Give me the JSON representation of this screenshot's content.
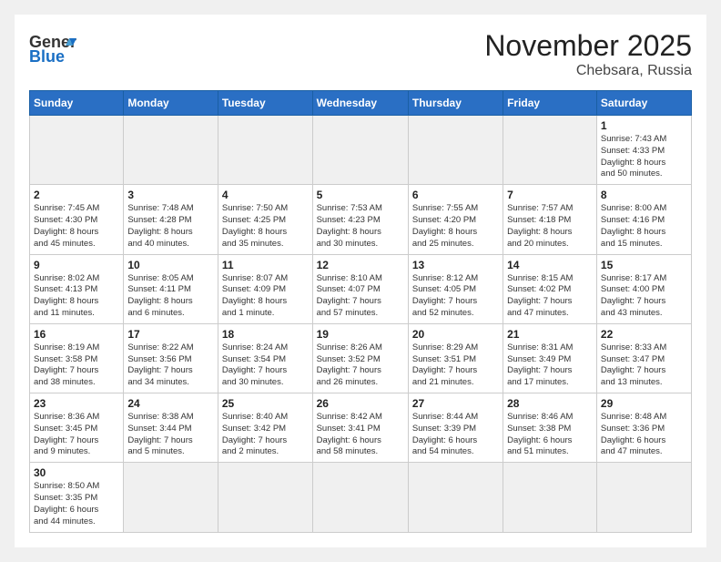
{
  "header": {
    "logo_general": "General",
    "logo_blue": "Blue",
    "title": "November 2025",
    "subtitle": "Chebsara, Russia"
  },
  "weekdays": [
    "Sunday",
    "Monday",
    "Tuesday",
    "Wednesday",
    "Thursday",
    "Friday",
    "Saturday"
  ],
  "weeks": [
    [
      {
        "day": "",
        "info": ""
      },
      {
        "day": "",
        "info": ""
      },
      {
        "day": "",
        "info": ""
      },
      {
        "day": "",
        "info": ""
      },
      {
        "day": "",
        "info": ""
      },
      {
        "day": "",
        "info": ""
      },
      {
        "day": "1",
        "info": "Sunrise: 7:43 AM\nSunset: 4:33 PM\nDaylight: 8 hours\nand 50 minutes."
      }
    ],
    [
      {
        "day": "2",
        "info": "Sunrise: 7:45 AM\nSunset: 4:30 PM\nDaylight: 8 hours\nand 45 minutes."
      },
      {
        "day": "3",
        "info": "Sunrise: 7:48 AM\nSunset: 4:28 PM\nDaylight: 8 hours\nand 40 minutes."
      },
      {
        "day": "4",
        "info": "Sunrise: 7:50 AM\nSunset: 4:25 PM\nDaylight: 8 hours\nand 35 minutes."
      },
      {
        "day": "5",
        "info": "Sunrise: 7:53 AM\nSunset: 4:23 PM\nDaylight: 8 hours\nand 30 minutes."
      },
      {
        "day": "6",
        "info": "Sunrise: 7:55 AM\nSunset: 4:20 PM\nDaylight: 8 hours\nand 25 minutes."
      },
      {
        "day": "7",
        "info": "Sunrise: 7:57 AM\nSunset: 4:18 PM\nDaylight: 8 hours\nand 20 minutes."
      },
      {
        "day": "8",
        "info": "Sunrise: 8:00 AM\nSunset: 4:16 PM\nDaylight: 8 hours\nand 15 minutes."
      }
    ],
    [
      {
        "day": "9",
        "info": "Sunrise: 8:02 AM\nSunset: 4:13 PM\nDaylight: 8 hours\nand 11 minutes."
      },
      {
        "day": "10",
        "info": "Sunrise: 8:05 AM\nSunset: 4:11 PM\nDaylight: 8 hours\nand 6 minutes."
      },
      {
        "day": "11",
        "info": "Sunrise: 8:07 AM\nSunset: 4:09 PM\nDaylight: 8 hours\nand 1 minute."
      },
      {
        "day": "12",
        "info": "Sunrise: 8:10 AM\nSunset: 4:07 PM\nDaylight: 7 hours\nand 57 minutes."
      },
      {
        "day": "13",
        "info": "Sunrise: 8:12 AM\nSunset: 4:05 PM\nDaylight: 7 hours\nand 52 minutes."
      },
      {
        "day": "14",
        "info": "Sunrise: 8:15 AM\nSunset: 4:02 PM\nDaylight: 7 hours\nand 47 minutes."
      },
      {
        "day": "15",
        "info": "Sunrise: 8:17 AM\nSunset: 4:00 PM\nDaylight: 7 hours\nand 43 minutes."
      }
    ],
    [
      {
        "day": "16",
        "info": "Sunrise: 8:19 AM\nSunset: 3:58 PM\nDaylight: 7 hours\nand 38 minutes."
      },
      {
        "day": "17",
        "info": "Sunrise: 8:22 AM\nSunset: 3:56 PM\nDaylight: 7 hours\nand 34 minutes."
      },
      {
        "day": "18",
        "info": "Sunrise: 8:24 AM\nSunset: 3:54 PM\nDaylight: 7 hours\nand 30 minutes."
      },
      {
        "day": "19",
        "info": "Sunrise: 8:26 AM\nSunset: 3:52 PM\nDaylight: 7 hours\nand 26 minutes."
      },
      {
        "day": "20",
        "info": "Sunrise: 8:29 AM\nSunset: 3:51 PM\nDaylight: 7 hours\nand 21 minutes."
      },
      {
        "day": "21",
        "info": "Sunrise: 8:31 AM\nSunset: 3:49 PM\nDaylight: 7 hours\nand 17 minutes."
      },
      {
        "day": "22",
        "info": "Sunrise: 8:33 AM\nSunset: 3:47 PM\nDaylight: 7 hours\nand 13 minutes."
      }
    ],
    [
      {
        "day": "23",
        "info": "Sunrise: 8:36 AM\nSunset: 3:45 PM\nDaylight: 7 hours\nand 9 minutes."
      },
      {
        "day": "24",
        "info": "Sunrise: 8:38 AM\nSunset: 3:44 PM\nDaylight: 7 hours\nand 5 minutes."
      },
      {
        "day": "25",
        "info": "Sunrise: 8:40 AM\nSunset: 3:42 PM\nDaylight: 7 hours\nand 2 minutes."
      },
      {
        "day": "26",
        "info": "Sunrise: 8:42 AM\nSunset: 3:41 PM\nDaylight: 6 hours\nand 58 minutes."
      },
      {
        "day": "27",
        "info": "Sunrise: 8:44 AM\nSunset: 3:39 PM\nDaylight: 6 hours\nand 54 minutes."
      },
      {
        "day": "28",
        "info": "Sunrise: 8:46 AM\nSunset: 3:38 PM\nDaylight: 6 hours\nand 51 minutes."
      },
      {
        "day": "29",
        "info": "Sunrise: 8:48 AM\nSunset: 3:36 PM\nDaylight: 6 hours\nand 47 minutes."
      }
    ],
    [
      {
        "day": "30",
        "info": "Sunrise: 8:50 AM\nSunset: 3:35 PM\nDaylight: 6 hours\nand 44 minutes."
      },
      {
        "day": "",
        "info": ""
      },
      {
        "day": "",
        "info": ""
      },
      {
        "day": "",
        "info": ""
      },
      {
        "day": "",
        "info": ""
      },
      {
        "day": "",
        "info": ""
      },
      {
        "day": "",
        "info": ""
      }
    ]
  ]
}
